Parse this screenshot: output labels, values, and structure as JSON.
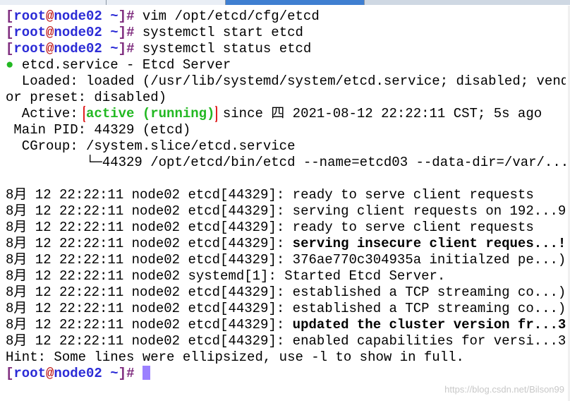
{
  "prompt": {
    "user": "root",
    "at": "@",
    "host": "node02",
    "path": "~",
    "symbol": "#"
  },
  "commands": [
    "vim /opt/etcd/cfg/etcd",
    "systemctl start etcd",
    "systemctl status etcd"
  ],
  "status": {
    "dot": "●",
    "header": "etcd.service - Etcd Server",
    "loaded_line": "  Loaded: loaded (/usr/lib/systemd/system/etcd.service; disabled; vend",
    "loaded_wrap": "or preset: disabled)",
    "active_label": "  Active: ",
    "active_state": "active (running)",
    "active_rest": " since 四 2021-08-12 22:22:11 CST; 5s ago",
    "mainpid": " Main PID: 44329 (etcd)",
    "cgroup": "  CGroup: /system.slice/etcd.service",
    "cgroup_proc": "          └─44329 /opt/etcd/bin/etcd --name=etcd03 --data-dir=/var/..."
  },
  "log_prefixes": [
    "8月 12 22:22:11 node02 etcd[44329]: ",
    "8月 12 22:22:11 node02 etcd[44329]: ",
    "8月 12 22:22:11 node02 etcd[44329]: ",
    "8月 12 22:22:11 node02 etcd[44329]: ",
    "8月 12 22:22:11 node02 etcd[44329]: ",
    "8月 12 22:22:11 node02 systemd[1]: ",
    "8月 12 22:22:11 node02 etcd[44329]: ",
    "8月 12 22:22:11 node02 etcd[44329]: ",
    "8月 12 22:22:11 node02 etcd[44329]: ",
    "8月 12 22:22:11 node02 etcd[44329]: "
  ],
  "log_messages": [
    "ready to serve client requests",
    "serving client requests on 192...9",
    "ready to serve client requests",
    "serving insecure client reques...!",
    "376ae770c304935a initialzed pe...)",
    "Started Etcd Server.",
    "established a TCP streaming co...)",
    "established a TCP streaming co...)",
    "updated the cluster version fr...3",
    "enabled capabilities for versi...3"
  ],
  "hint": "Hint: Some lines were ellipsized, use -l to show in full.",
  "watermark": "https://blog.csdn.net/Bilson99",
  "colors": {
    "prompt_bracket": "#7d2a7d",
    "prompt_user": "#2b2bd6",
    "prompt_at": "#c02020",
    "active_green": "#22b822",
    "highlight_box": "#e02020",
    "cursor": "#9b80ff"
  }
}
